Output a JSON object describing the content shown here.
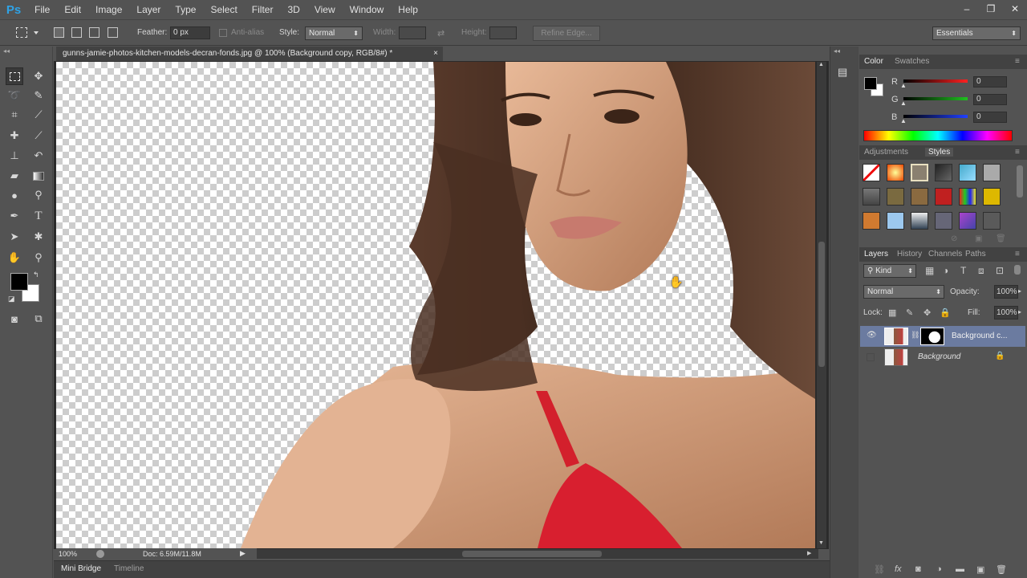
{
  "app": {
    "logo": "Ps",
    "menus": [
      "File",
      "Edit",
      "Image",
      "Layer",
      "Type",
      "Select",
      "Filter",
      "3D",
      "View",
      "Window",
      "Help"
    ],
    "window_controls": [
      "–",
      "❐",
      "✕"
    ]
  },
  "options": {
    "feather_label": "Feather:",
    "feather_value": "0 px",
    "antialias_label": "Anti-alias",
    "style_label": "Style:",
    "style_value": "Normal",
    "width_label": "Width:",
    "height_label": "Height:",
    "refine_edge": "Refine Edge...",
    "workspace": "Essentials"
  },
  "document": {
    "tab_title": "gunns-jamie-photos-kitchen-models-decran-fonds.jpg @ 100% (Background copy, RGB/8#) *",
    "close": "×",
    "zoom": "100%",
    "doc_info": "Doc: 6.59M/11.8M"
  },
  "bottom_tabs": [
    "Mini Bridge",
    "Timeline"
  ],
  "color_panel": {
    "tabs": [
      "Color",
      "Swatches"
    ],
    "channels": [
      {
        "label": "R",
        "value": "0",
        "color": "#ff2020"
      },
      {
        "label": "G",
        "value": "0",
        "color": "#20c020"
      },
      {
        "label": "B",
        "value": "0",
        "color": "#2040ff"
      }
    ]
  },
  "styles_panel": {
    "tabs": [
      "Adjustments",
      "Styles"
    ]
  },
  "layers_panel": {
    "tabs": [
      "Layers",
      "History",
      "Channels",
      "Paths"
    ],
    "filter_kind": "Kind",
    "blend_mode": "Normal",
    "opacity_label": "Opacity:",
    "opacity_value": "100%",
    "lock_label": "Lock:",
    "fill_label": "Fill:",
    "fill_value": "100%",
    "layers": [
      {
        "name": "Background c...",
        "visible": true,
        "selected": true
      },
      {
        "name": "Background",
        "visible": false,
        "selected": false
      }
    ]
  }
}
